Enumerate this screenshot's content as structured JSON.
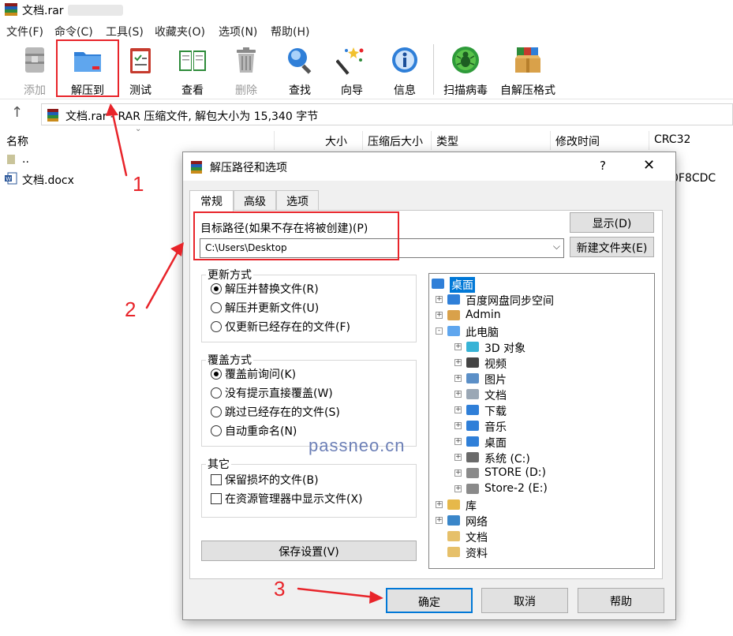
{
  "window": {
    "title": "文档.rar"
  },
  "menu": [
    "文件(F)",
    "命令(C)",
    "工具(S)",
    "收藏夹(O)",
    "选项(N)",
    "帮助(H)"
  ],
  "toolbar": [
    {
      "label": "添加",
      "icon": "archive-add-icon",
      "disabled": true
    },
    {
      "label": "解压到",
      "icon": "extract-folder-icon",
      "disabled": false
    },
    {
      "label": "测试",
      "icon": "test-clipboard-icon",
      "disabled": false
    },
    {
      "label": "查看",
      "icon": "view-book-icon",
      "disabled": false
    },
    {
      "label": "删除",
      "icon": "trash-icon",
      "disabled": true
    },
    {
      "label": "查找",
      "icon": "magnifier-icon",
      "disabled": false
    },
    {
      "label": "向导",
      "icon": "wizard-wand-icon",
      "disabled": false
    },
    {
      "label": "信息",
      "icon": "info-icon",
      "disabled": false
    },
    {
      "label": "扫描病毒",
      "icon": "virus-scan-icon",
      "disabled": false
    },
    {
      "label": "自解压格式",
      "icon": "sfx-box-icon",
      "disabled": false
    }
  ],
  "address": {
    "text": "文档.rar - RAR 压缩文件, 解包大小为 15,340 字节"
  },
  "list": {
    "columns": [
      "名称",
      "大小",
      "压缩后大小",
      "类型",
      "修改时间",
      "CRC32"
    ],
    "rows": [
      {
        "name": "..",
        "crc": ""
      },
      {
        "name": "文档.docx",
        "crc": "0F8CDC"
      }
    ]
  },
  "dialog": {
    "title": "解压路径和选项",
    "help": "?",
    "tabs": [
      "常规",
      "高级",
      "选项"
    ],
    "path_label": "目标路径(如果不存在将被创建)(P)",
    "path_value": "C:\\Users\\Desktop",
    "show_button": "显示(D)",
    "new_folder_button": "新建文件夹(E)",
    "update_mode": {
      "title": "更新方式",
      "options": [
        "解压并替换文件(R)",
        "解压并更新文件(U)",
        "仅更新已经存在的文件(F)"
      ],
      "selected": 0
    },
    "overwrite_mode": {
      "title": "覆盖方式",
      "options": [
        "覆盖前询问(K)",
        "没有提示直接覆盖(W)",
        "跳过已经存在的文件(S)",
        "自动重命名(N)"
      ],
      "selected": 0
    },
    "misc": {
      "title": "其它",
      "options": [
        "保留损坏的文件(B)",
        "在资源管理器中显示文件(X)"
      ]
    },
    "save_button": "保存设置(V)",
    "tree": [
      {
        "label": "桌面",
        "icon": "desktop-icon",
        "level": 0,
        "expand": "",
        "selected": true
      },
      {
        "label": "百度网盘同步空间",
        "icon": "baidu-cloud-icon",
        "level": 1,
        "expand": "+"
      },
      {
        "label": "Admin",
        "icon": "user-icon",
        "level": 1,
        "expand": "+"
      },
      {
        "label": "此电脑",
        "icon": "computer-icon",
        "level": 1,
        "expand": "-"
      },
      {
        "label": "3D 对象",
        "icon": "3d-objects-icon",
        "level": 2,
        "expand": "+"
      },
      {
        "label": "视频",
        "icon": "video-icon",
        "level": 2,
        "expand": "+"
      },
      {
        "label": "图片",
        "icon": "pictures-icon",
        "level": 2,
        "expand": "+"
      },
      {
        "label": "文档",
        "icon": "documents-icon",
        "level": 2,
        "expand": "+"
      },
      {
        "label": "下载",
        "icon": "download-icon",
        "level": 2,
        "expand": "+"
      },
      {
        "label": "音乐",
        "icon": "music-icon",
        "level": 2,
        "expand": "+"
      },
      {
        "label": "桌面",
        "icon": "desktop-icon",
        "level": 2,
        "expand": "+"
      },
      {
        "label": "系统 (C:)",
        "icon": "system-drive-icon",
        "level": 2,
        "expand": "+"
      },
      {
        "label": "STORE (D:)",
        "icon": "drive-icon",
        "level": 2,
        "expand": "+"
      },
      {
        "label": "Store-2 (E:)",
        "icon": "drive-icon",
        "level": 2,
        "expand": "+"
      },
      {
        "label": "库",
        "icon": "library-icon",
        "level": 1,
        "expand": "+"
      },
      {
        "label": "网络",
        "icon": "network-icon",
        "level": 1,
        "expand": "+"
      },
      {
        "label": "文档",
        "icon": "folder-icon",
        "level": 1,
        "expand": ""
      },
      {
        "label": "资料",
        "icon": "folder-icon",
        "level": 1,
        "expand": ""
      }
    ],
    "ok_button": "确定",
    "cancel_button": "取消",
    "help_button": "帮助"
  },
  "annotations": {
    "step1": "1",
    "step2": "2",
    "step3": "3",
    "accent": "#e8242a"
  },
  "watermark": "passneo.cn"
}
